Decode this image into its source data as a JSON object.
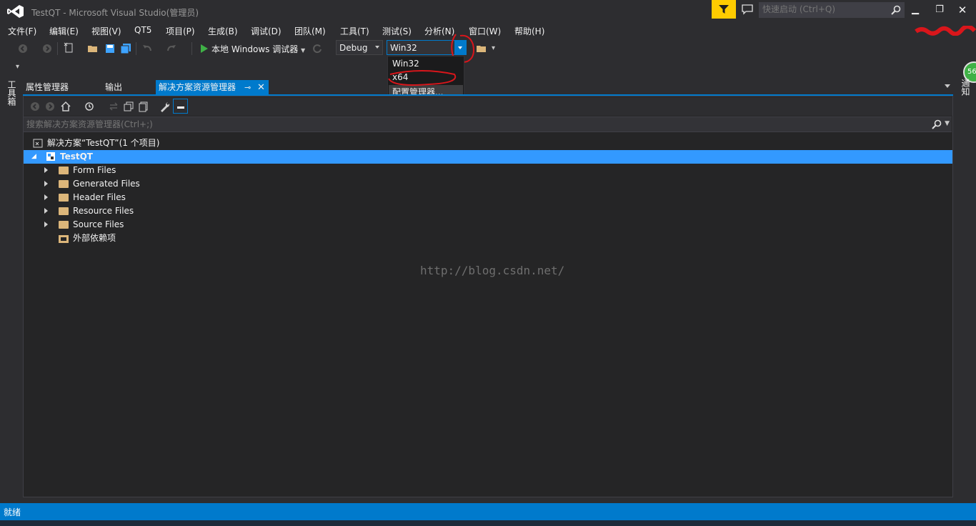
{
  "window": {
    "title": "TestQT - Microsoft Visual Studio(管理员)",
    "quick_launch_placeholder": "快速启动 (Ctrl+Q)"
  },
  "menu": {
    "items": [
      {
        "label": "文件(F)"
      },
      {
        "label": "编辑(E)"
      },
      {
        "label": "视图(V)"
      },
      {
        "label": "QT5"
      },
      {
        "label": "项目(P)"
      },
      {
        "label": "生成(B)"
      },
      {
        "label": "调试(D)"
      },
      {
        "label": "团队(M)"
      },
      {
        "label": "工具(T)"
      },
      {
        "label": "测试(S)"
      },
      {
        "label": "分析(N)"
      },
      {
        "label": "窗口(W)"
      },
      {
        "label": "帮助(H)"
      }
    ]
  },
  "toolbar": {
    "debug_target": "本地 Windows 调试器",
    "configuration": "Debug",
    "platform": "Win32"
  },
  "platform_dropdown": {
    "options": [
      "Win32",
      "x64",
      "配置管理器..."
    ]
  },
  "side_tabs": {
    "left": "工具箱",
    "right": "通知",
    "notification_count": "56"
  },
  "tabs": [
    {
      "label": "属性管理器"
    },
    {
      "label": "输出"
    },
    {
      "label": "解决方案资源管理器",
      "active": true
    }
  ],
  "solution_explorer": {
    "search_placeholder": "搜索解决方案资源管理器(Ctrl+;)",
    "solution": "解决方案“TestQT”(1 个项目)",
    "project": "TestQT",
    "folders": [
      "Form Files",
      "Generated Files",
      "Header Files",
      "Resource Files",
      "Source Files"
    ],
    "external_deps": "外部依赖项"
  },
  "watermark": "http://blog.csdn.net/",
  "status": {
    "text": "就绪"
  },
  "colors": {
    "accent": "#007acc",
    "selection": "#3399ff",
    "background": "#2d2d30",
    "panel": "#252526",
    "filter": "#ffcc00",
    "annotation": "#d9161b"
  }
}
